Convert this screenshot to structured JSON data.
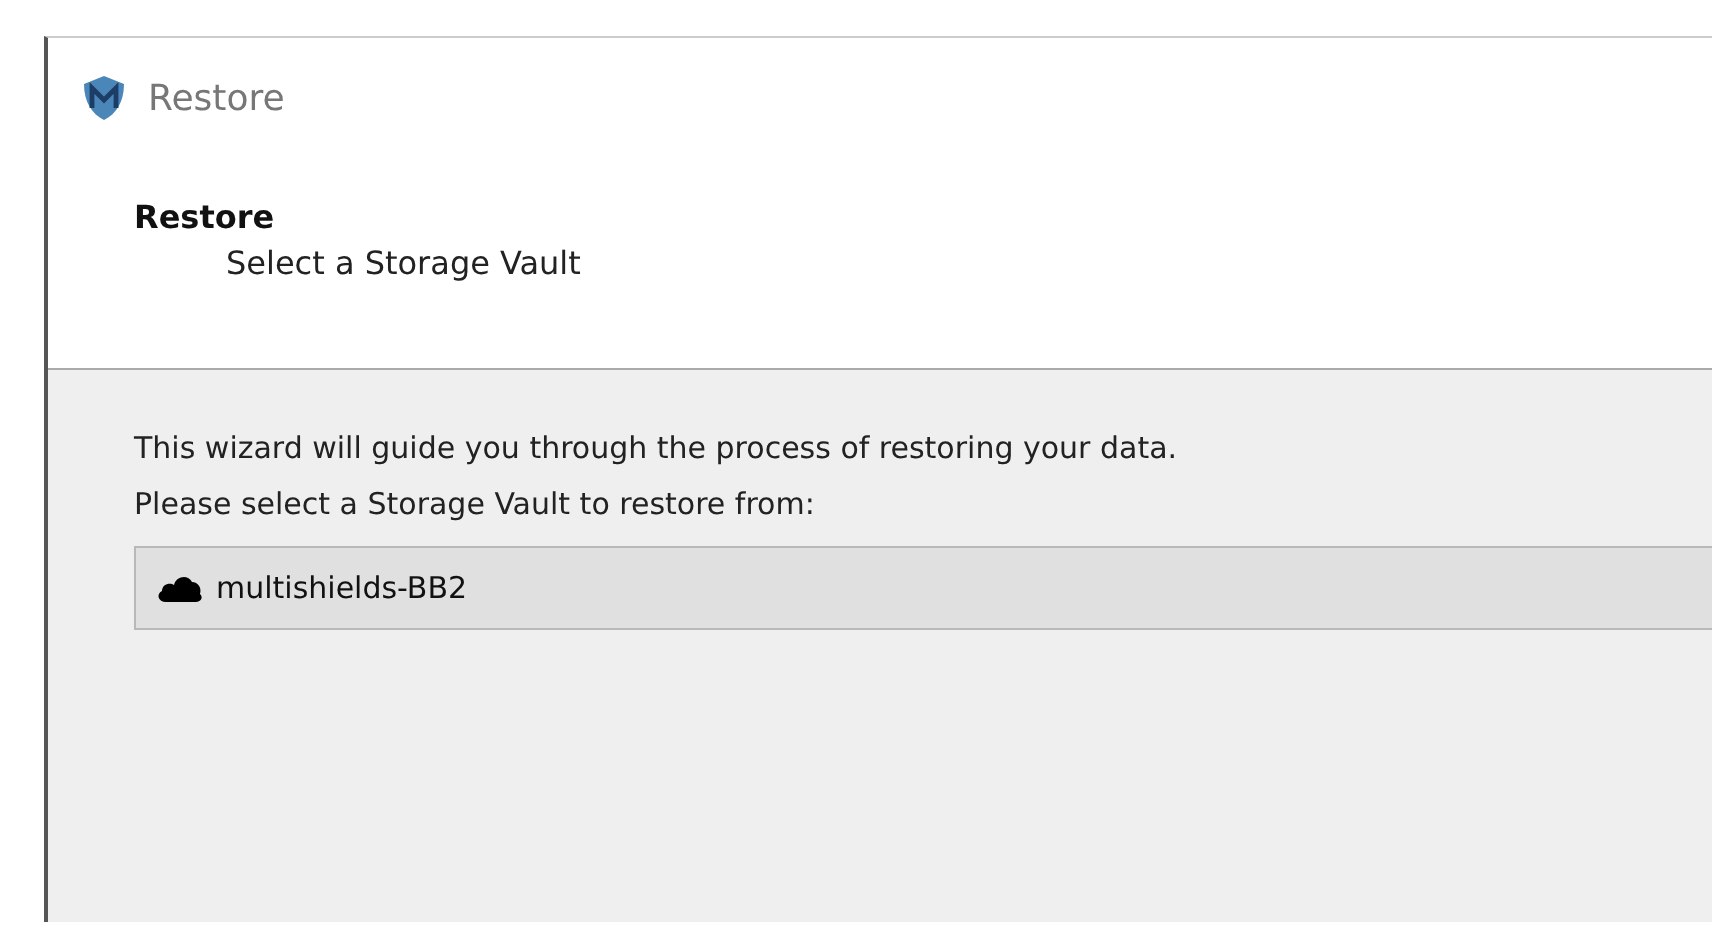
{
  "window": {
    "title": "Restore"
  },
  "header": {
    "title": "Restore",
    "subtitle": "Select a Storage Vault"
  },
  "body": {
    "intro": "This wizard will guide you through the process of restoring your data.",
    "prompt": "Please select a Storage Vault to restore from:"
  },
  "vaults": [
    {
      "name": "multishields-BB2",
      "selected": true
    }
  ]
}
